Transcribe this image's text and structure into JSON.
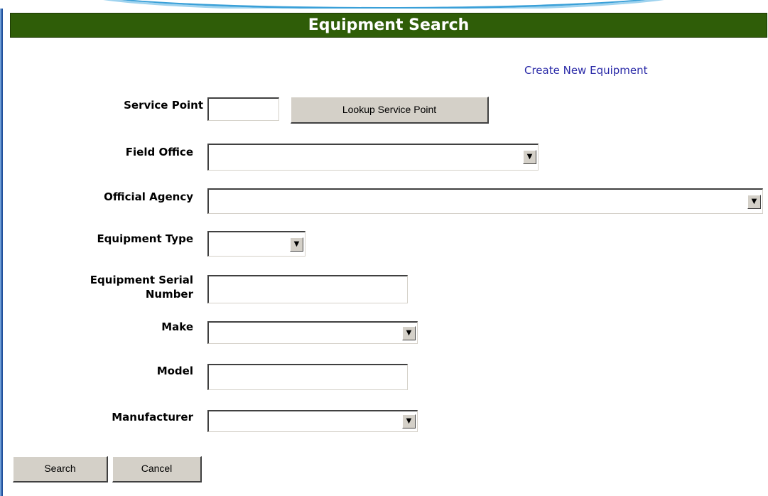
{
  "title": "Equipment Search",
  "create_link": "Create New Equipment",
  "fields": {
    "service_point": {
      "label": "Service Point",
      "value": ""
    },
    "field_office": {
      "label": "Field Office",
      "selected": ""
    },
    "official_agency": {
      "label": "Official Agency",
      "selected": ""
    },
    "equipment_type": {
      "label": "Equipment Type",
      "selected": ""
    },
    "serial_number": {
      "label_line1": "Equipment Serial",
      "label_line2": "Number",
      "value": ""
    },
    "make": {
      "label": "Make",
      "selected": ""
    },
    "model": {
      "label": "Model",
      "value": ""
    },
    "manufacturer": {
      "label": "Manufacturer",
      "selected": ""
    }
  },
  "buttons": {
    "lookup": "Lookup Service Point",
    "search": "Search",
    "cancel": "Cancel"
  },
  "icons": {
    "dropdown": "chevron-down-icon",
    "dropdown_glyph": "▼"
  },
  "colors": {
    "title_bar_bg": "#2f5d08",
    "link": "#2b2ba8",
    "button_face": "#d4d0c8"
  }
}
